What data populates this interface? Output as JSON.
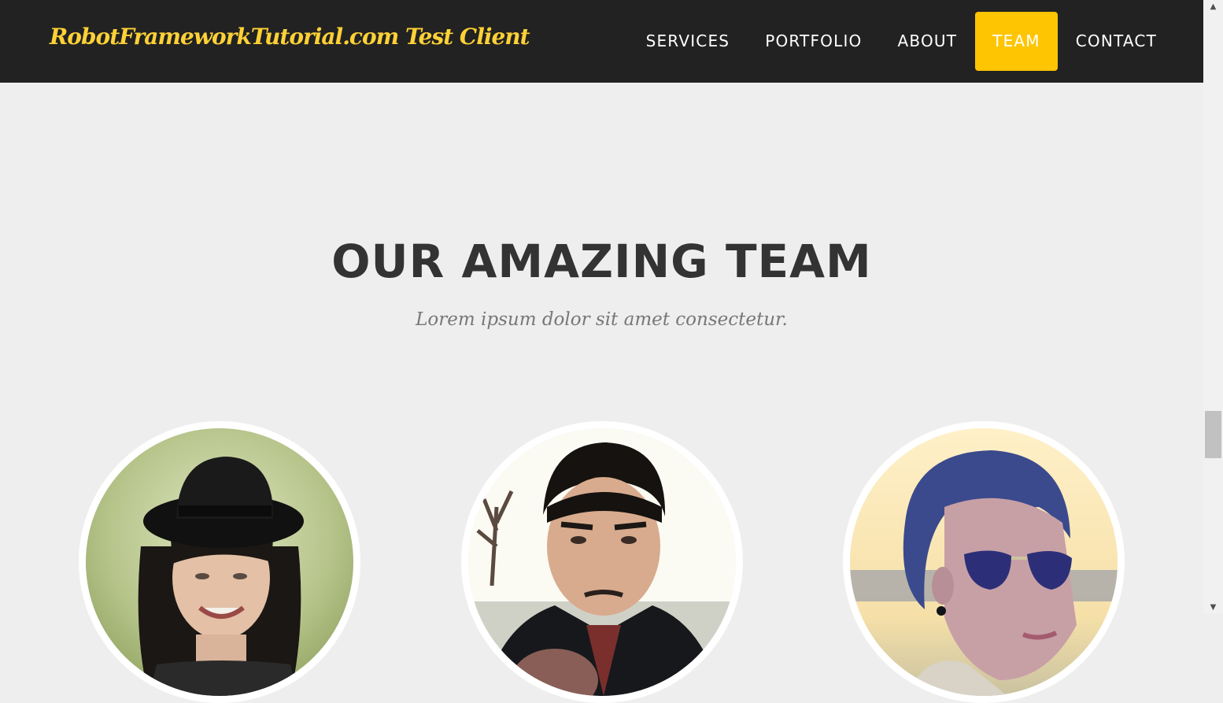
{
  "navbar": {
    "brand": "RobotFrameworkTutorial.com Test Client",
    "items": [
      {
        "label": "SERVICES",
        "active": false
      },
      {
        "label": "PORTFOLIO",
        "active": false
      },
      {
        "label": "ABOUT",
        "active": false
      },
      {
        "label": "TEAM",
        "active": true
      },
      {
        "label": "CONTACT",
        "active": false
      }
    ]
  },
  "team": {
    "heading": "OUR AMAZING TEAM",
    "subheading": "Lorem ipsum dolor sit amet consectetur."
  },
  "colors": {
    "navbar_bg": "#222222",
    "accent": "#fed136",
    "active_nav_bg": "#fec503",
    "page_bg": "#eeeeee",
    "heading": "#333333",
    "subheading": "#777777"
  },
  "scrollbar": {
    "up_icon": "scroll-up-arrow-icon",
    "down_icon": "scroll-down-arrow-icon"
  }
}
